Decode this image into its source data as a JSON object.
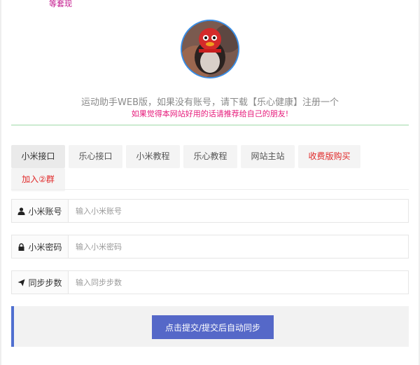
{
  "top_note": "等套现",
  "intro": "运动助手WEB版，如果没有账号，请下载【乐心健康】注册一个",
  "recommend": "如果觉得本网站好用的话请推荐给自己的朋友!",
  "tabs": [
    {
      "label": "小米接口"
    },
    {
      "label": "乐心接口"
    },
    {
      "label": "小米教程"
    },
    {
      "label": "乐心教程"
    },
    {
      "label": "网站主站"
    },
    {
      "label": "收费版购买"
    },
    {
      "label": "加入②群"
    }
  ],
  "form": {
    "account": {
      "label": "小米账号",
      "placeholder": "输入小米账号",
      "icon": "user-icon"
    },
    "password": {
      "label": "小米密码",
      "placeholder": "输入小米密码",
      "icon": "lock-icon"
    },
    "steps": {
      "label": "同步步数",
      "placeholder": "输入同步步数",
      "icon": "send-icon"
    }
  },
  "submit_label": "点击提交/提交后自动同步",
  "colors": {
    "accent": "#5568c8",
    "divider": "#9fd8a8",
    "pink": "#e6197a",
    "red": "#e02828"
  }
}
